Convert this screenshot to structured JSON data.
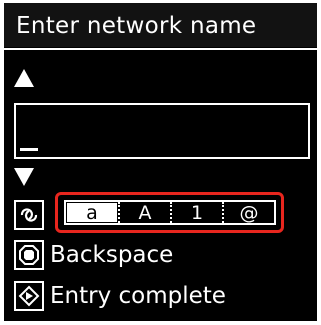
{
  "screen": {
    "title": "Enter network name",
    "scroll_up_icon": "triangle-up",
    "scroll_down_icon": "triangle-down",
    "input": {
      "value": "",
      "cursor": "_"
    },
    "mode_selector": {
      "key_icon": "rotate-arrows",
      "modes": [
        "a",
        "A",
        "1",
        "@"
      ],
      "selected": "a",
      "highlight_color": "#e8261e"
    },
    "backspace": {
      "key_icon": "stop-button",
      "label": "Backspace"
    },
    "entry_complete": {
      "key_icon": "start-diamond",
      "label": "Entry complete"
    }
  }
}
